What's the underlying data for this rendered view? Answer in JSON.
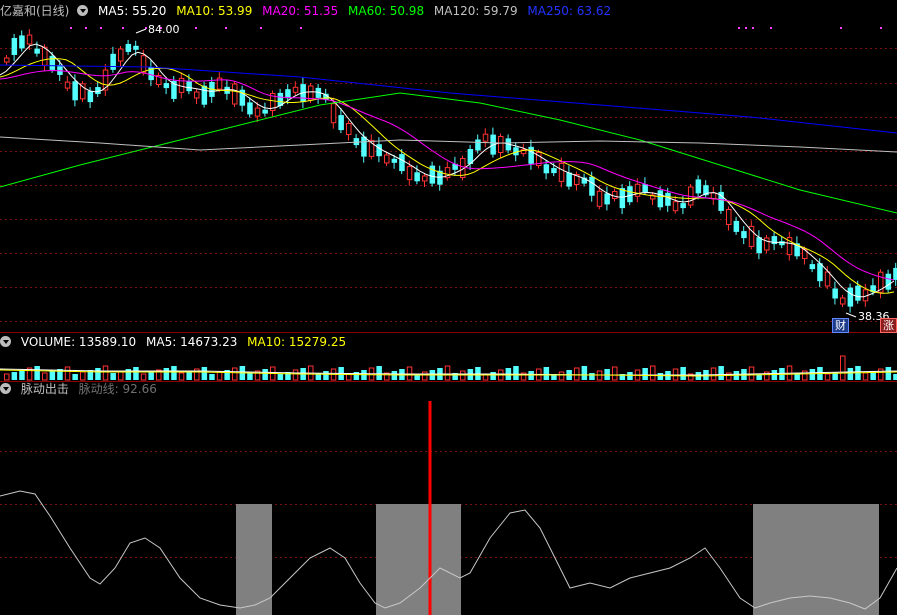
{
  "stock": {
    "name": "亿嘉和(日线)",
    "ma5_label": "MA5: 55.20",
    "ma10_label": "MA10: 53.99",
    "ma20_label": "MA20: 51.35",
    "ma60_label": "MA60: 50.98",
    "ma120_label": "MA120: 59.79",
    "ma250_label": "MA250: 63.62",
    "high_label": "84.00",
    "low_label": "38.36",
    "badge_cai": "财",
    "badge_zhang": "涨"
  },
  "volume": {
    "label": "VOLUME: 13589.10",
    "ma5_label": "MA5: 14673.23",
    "ma10_label": "MA10: 15279.25"
  },
  "indicator": {
    "name": "脉动出击",
    "line_label": "脉动线: 92.66"
  },
  "colors": {
    "up": "#ff3232",
    "down": "#54ffff",
    "ma5": "#ffffff",
    "ma10": "#ffff00",
    "ma20": "#ff00ff",
    "ma60": "#00ff00",
    "ma120": "#c0c0c0",
    "ma250": "#0000ff",
    "signal": "#ff0000",
    "zone": "#808080"
  }
}
